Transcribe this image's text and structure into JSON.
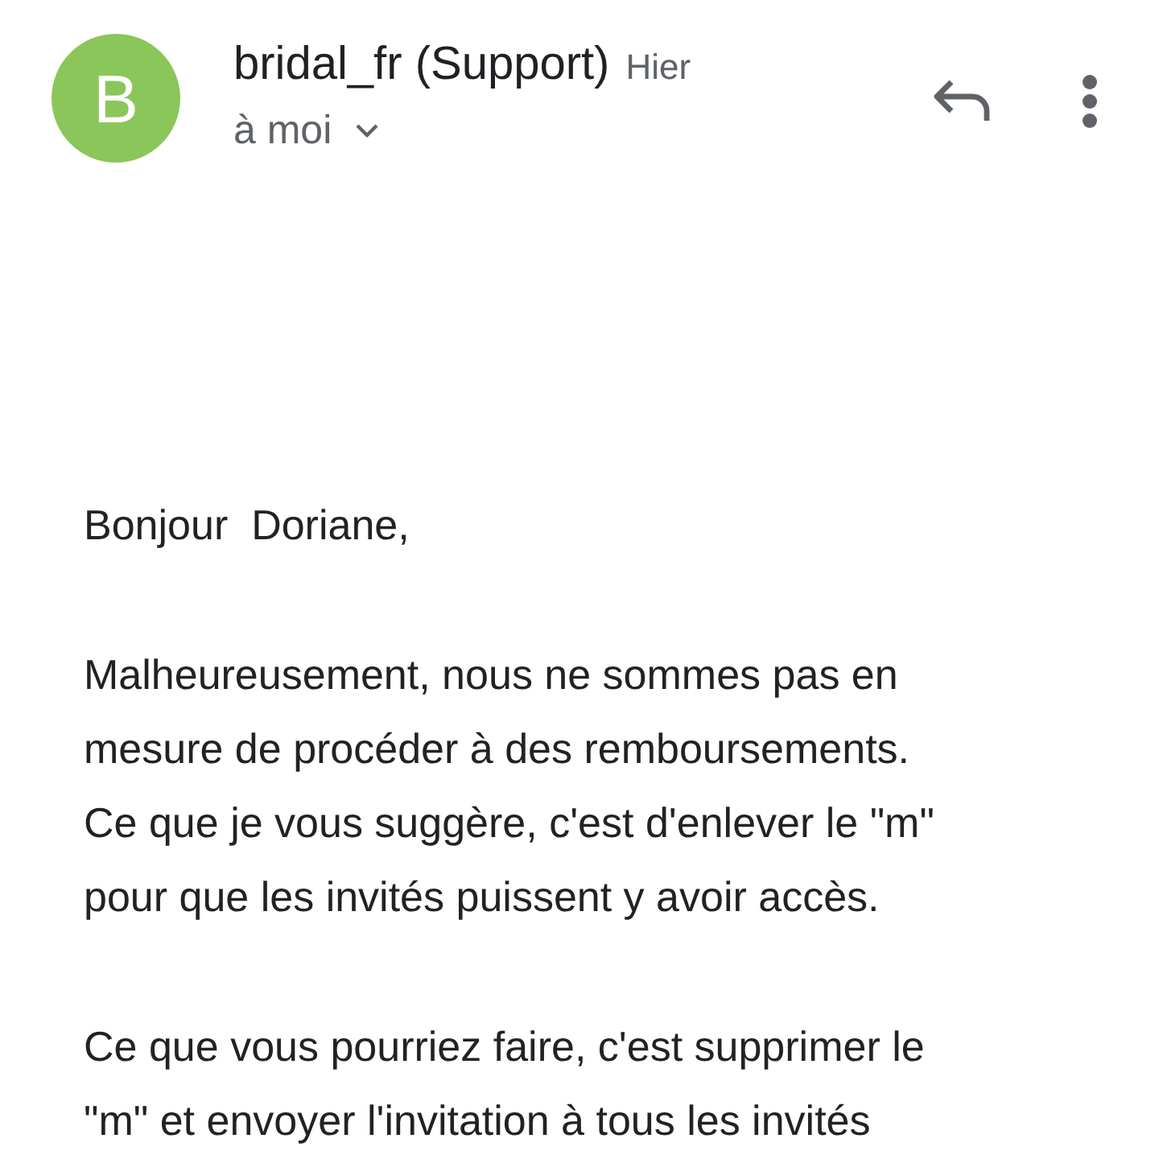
{
  "message": {
    "avatar_letter": "B",
    "sender": "bridal_fr (Support)",
    "date": "Hier",
    "recipient": "à moi"
  },
  "body": [
    {
      "lines": [
        "Bonjour  Doriane,"
      ]
    },
    {
      "lines": [
        "Malheureusement, nous ne sommes pas en",
        "mesure de procéder à des remboursements.",
        "Ce que je vous suggère, c'est d'enlever le \"m\"",
        "pour que les invités puissent y avoir accès."
      ]
    },
    {
      "lines": [
        "Ce que vous pourriez faire, c'est supprimer le",
        "\"m\" et envoyer l'invitation à tous les invités"
      ]
    }
  ]
}
